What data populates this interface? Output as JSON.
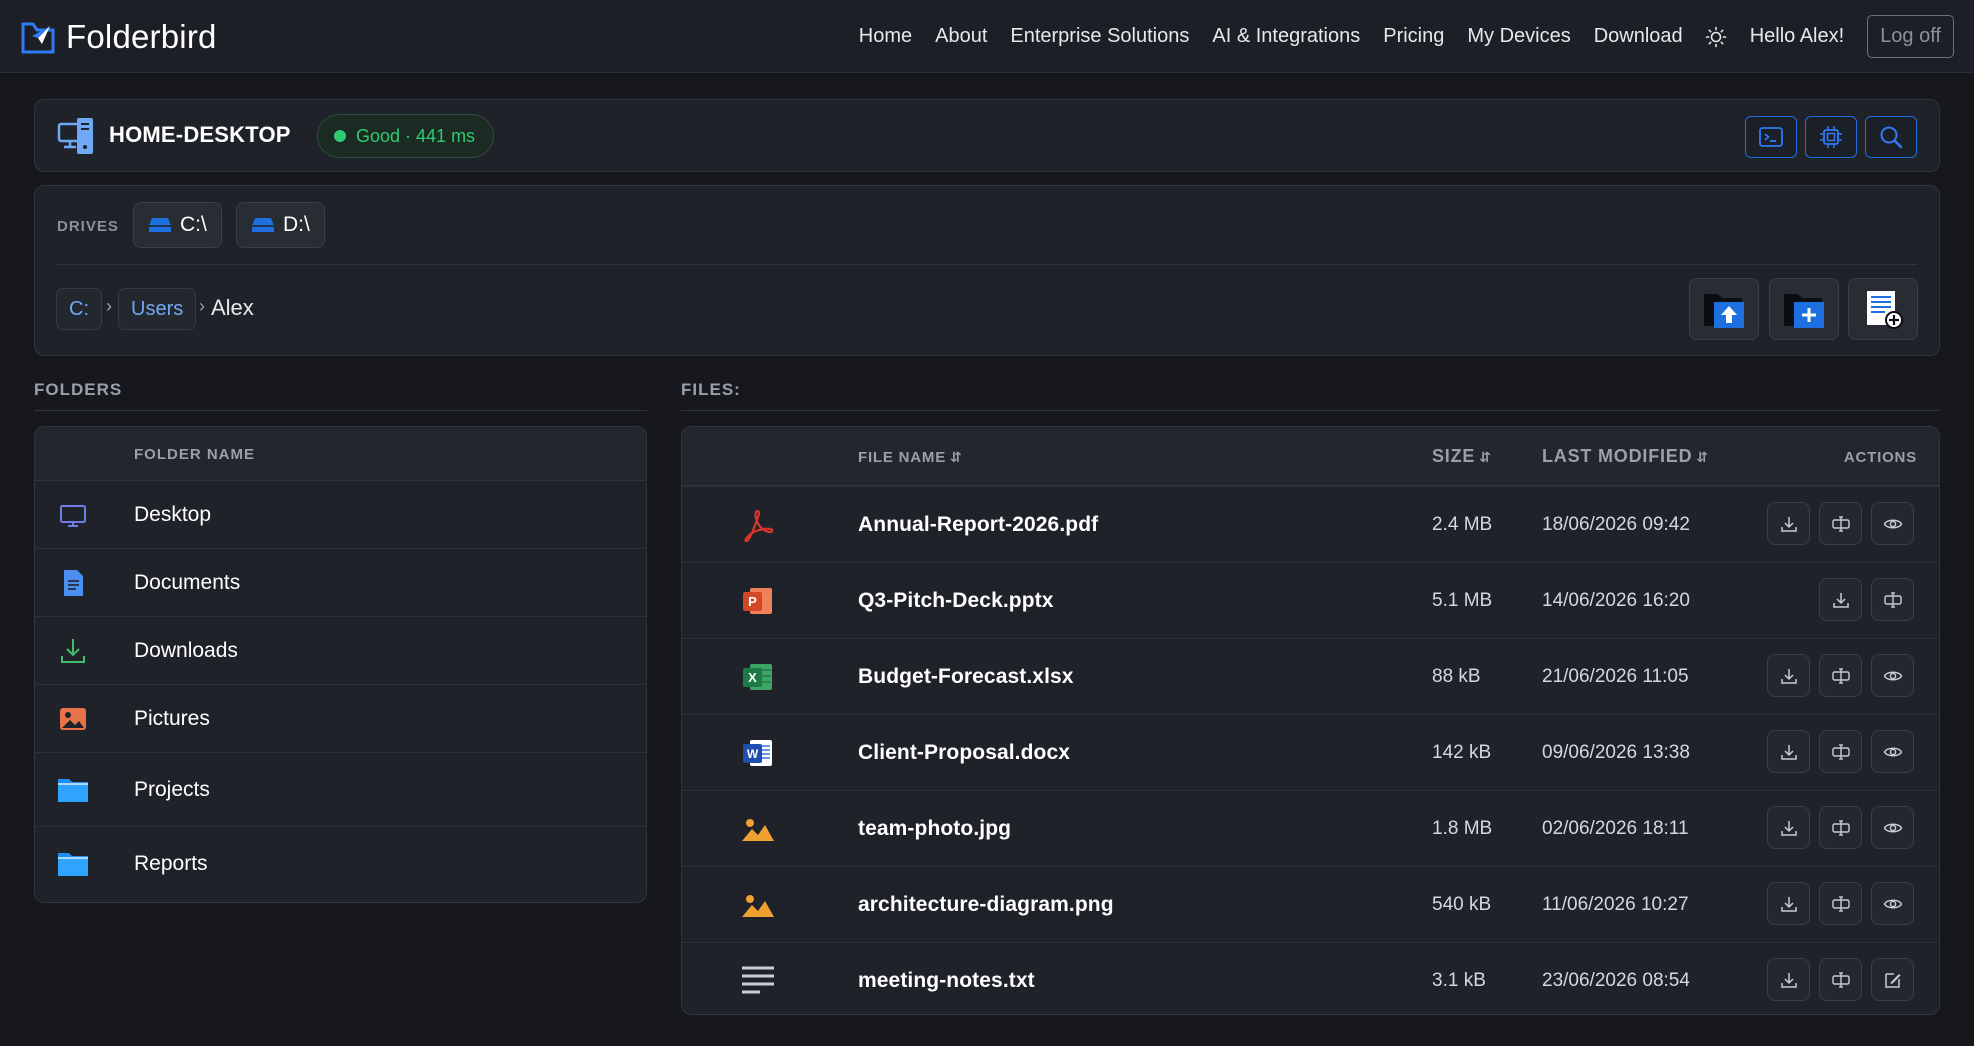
{
  "nav": {
    "brand": "Folderbird",
    "links": [
      "Home",
      "About",
      "Enterprise Solutions",
      "AI & Integrations",
      "Pricing",
      "My Devices",
      "Download"
    ],
    "hello": "Hello Alex!",
    "logoff": "Log off"
  },
  "device": {
    "name": "HOME-DESKTOP",
    "status": "Good · 441 ms",
    "status_color": "#2ecc71",
    "tools": [
      "terminal-icon",
      "cpu-icon",
      "search-icon"
    ]
  },
  "drives": {
    "label": "DRIVES",
    "items": [
      "C:\\",
      "D:\\"
    ]
  },
  "breadcrumb": {
    "items": [
      "C:",
      "Users"
    ],
    "sep": "›",
    "current": "Alex"
  },
  "folders": {
    "title": "FOLDERS",
    "header": "FOLDER NAME",
    "items": [
      {
        "name": "Desktop",
        "icon": "desktop-icon"
      },
      {
        "name": "Documents",
        "icon": "document-icon"
      },
      {
        "name": "Downloads",
        "icon": "download-icon"
      },
      {
        "name": "Pictures",
        "icon": "picture-icon"
      },
      {
        "name": "Projects",
        "icon": "folder-icon"
      },
      {
        "name": "Reports",
        "icon": "folder-icon"
      }
    ]
  },
  "files": {
    "title": "FILES:",
    "headers": {
      "name": "FILE NAME",
      "size": "SIZE",
      "modified": "LAST MODIFIED",
      "actions": "ACTIONS"
    },
    "items": [
      {
        "name": "Annual-Report-2026.pdf",
        "size": "2.4 MB",
        "modified": "18/06/2026 09:42",
        "type": "pdf",
        "actions": [
          "download",
          "rename",
          "view"
        ]
      },
      {
        "name": "Q3-Pitch-Deck.pptx",
        "size": "5.1 MB",
        "modified": "14/06/2026 16:20",
        "type": "pptx",
        "actions": [
          "download",
          "rename"
        ]
      },
      {
        "name": "Budget-Forecast.xlsx",
        "size": "88 kB",
        "modified": "21/06/2026 11:05",
        "type": "xlsx",
        "actions": [
          "download",
          "rename",
          "view"
        ]
      },
      {
        "name": "Client-Proposal.docx",
        "size": "142 kB",
        "modified": "09/06/2026 13:38",
        "type": "docx",
        "actions": [
          "download",
          "rename",
          "view"
        ]
      },
      {
        "name": "team-photo.jpg",
        "size": "1.8 MB",
        "modified": "02/06/2026 18:11",
        "type": "image",
        "actions": [
          "download",
          "rename",
          "view"
        ]
      },
      {
        "name": "architecture-diagram.png",
        "size": "540 kB",
        "modified": "11/06/2026 10:27",
        "type": "image",
        "actions": [
          "download",
          "rename",
          "view"
        ]
      },
      {
        "name": "meeting-notes.txt",
        "size": "3.1 kB",
        "modified": "23/06/2026 08:54",
        "type": "txt",
        "actions": [
          "download",
          "rename",
          "edit"
        ]
      }
    ]
  },
  "colors": {
    "accent": "#1e6fe0",
    "link": "#6fa8f5",
    "good": "#2ecc71"
  }
}
